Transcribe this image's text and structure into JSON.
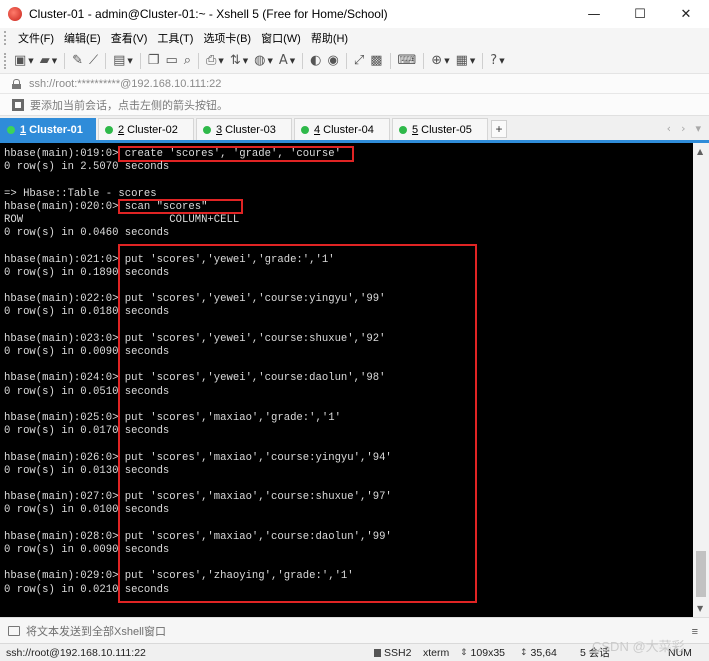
{
  "window": {
    "title": "Cluster-01 - admin@Cluster-01:~ - Xshell 5 (Free for Home/School)",
    "minimize_glyph": "—",
    "maximize_glyph": "☐",
    "close_glyph": "✕"
  },
  "menu": {
    "items": [
      "文件(F)",
      "编辑(E)",
      "查看(V)",
      "工具(T)",
      "选项卡(B)",
      "窗口(W)",
      "帮助(H)"
    ]
  },
  "toolbar": {
    "icons": [
      "new-session-icon",
      "open-folder-icon",
      "edit-icon",
      "disconnect-icon",
      "properties-icon",
      "copy-icon",
      "paste-icon",
      "find-icon",
      "print-icon",
      "transfer-icon",
      "globe-icon",
      "font-icon",
      "xftp-icon",
      "script-icon",
      "fullscreen-icon",
      "lock-icon",
      "keyboard-icon",
      "add-icon",
      "layout-icon",
      "help-icon"
    ]
  },
  "address": {
    "text": "ssh://root:**********@192.168.10.111:22"
  },
  "hint": {
    "text": "要添加当前会话，点击左侧的箭头按钮。"
  },
  "tabs": [
    {
      "num": "1",
      "label": "Cluster-01",
      "active": true
    },
    {
      "num": "2",
      "label": "Cluster-02",
      "active": false
    },
    {
      "num": "3",
      "label": "Cluster-03",
      "active": false
    },
    {
      "num": "4",
      "label": "Cluster-04",
      "active": false
    },
    {
      "num": "5",
      "label": "Cluster-05",
      "active": false
    }
  ],
  "tab_controls": {
    "add": "+",
    "prev": "‹",
    "next": "›",
    "menu": "▾"
  },
  "terminal": {
    "lines": [
      "hbase(main):019:0> create 'scores', 'grade', 'course'",
      "0 row(s) in 2.5070 seconds",
      "",
      "=> Hbase::Table - scores",
      "hbase(main):020:0> scan \"scores\"",
      "ROW                       COLUMN+CELL",
      "0 row(s) in 0.0460 seconds",
      "",
      "hbase(main):021:0> put 'scores','yewei','grade:','1'",
      "0 row(s) in 0.1890 seconds",
      "",
      "hbase(main):022:0> put 'scores','yewei','course:yingyu','99'",
      "0 row(s) in 0.0180 seconds",
      "",
      "hbase(main):023:0> put 'scores','yewei','course:shuxue','92'",
      "0 row(s) in 0.0090 seconds",
      "",
      "hbase(main):024:0> put 'scores','yewei','course:daolun','98'",
      "0 row(s) in 0.0510 seconds",
      "",
      "hbase(main):025:0> put 'scores','maxiao','grade:','1'",
      "0 row(s) in 0.0170 seconds",
      "",
      "hbase(main):026:0> put 'scores','maxiao','course:yingyu','94'",
      "0 row(s) in 0.0130 seconds",
      "",
      "hbase(main):027:0> put 'scores','maxiao','course:shuxue','97'",
      "0 row(s) in 0.0100 seconds",
      "",
      "hbase(main):028:0> put 'scores','maxiao','course:daolun','99'",
      "0 row(s) in 0.0090 seconds",
      "",
      "hbase(main):029:0> put 'scores','zhaoying','grade:','1'",
      "0 row(s) in 0.0210 seconds"
    ]
  },
  "compose": {
    "text": "将文本发送到全部Xshell窗口",
    "menu": "≡"
  },
  "status": {
    "host": "ssh://root@192.168.10.111:22",
    "protocol": "SSH2",
    "term": "xterm",
    "size": "109x35",
    "position": "35,64",
    "sessions": "5 会话",
    "num": "NUM"
  },
  "watermark": "CSDN @大菜彩",
  "colors": {
    "accent": "#2f8cd9",
    "highlight": "#e02424",
    "terminal_bg": "#000000",
    "terminal_fg": "#dcdcdc"
  }
}
